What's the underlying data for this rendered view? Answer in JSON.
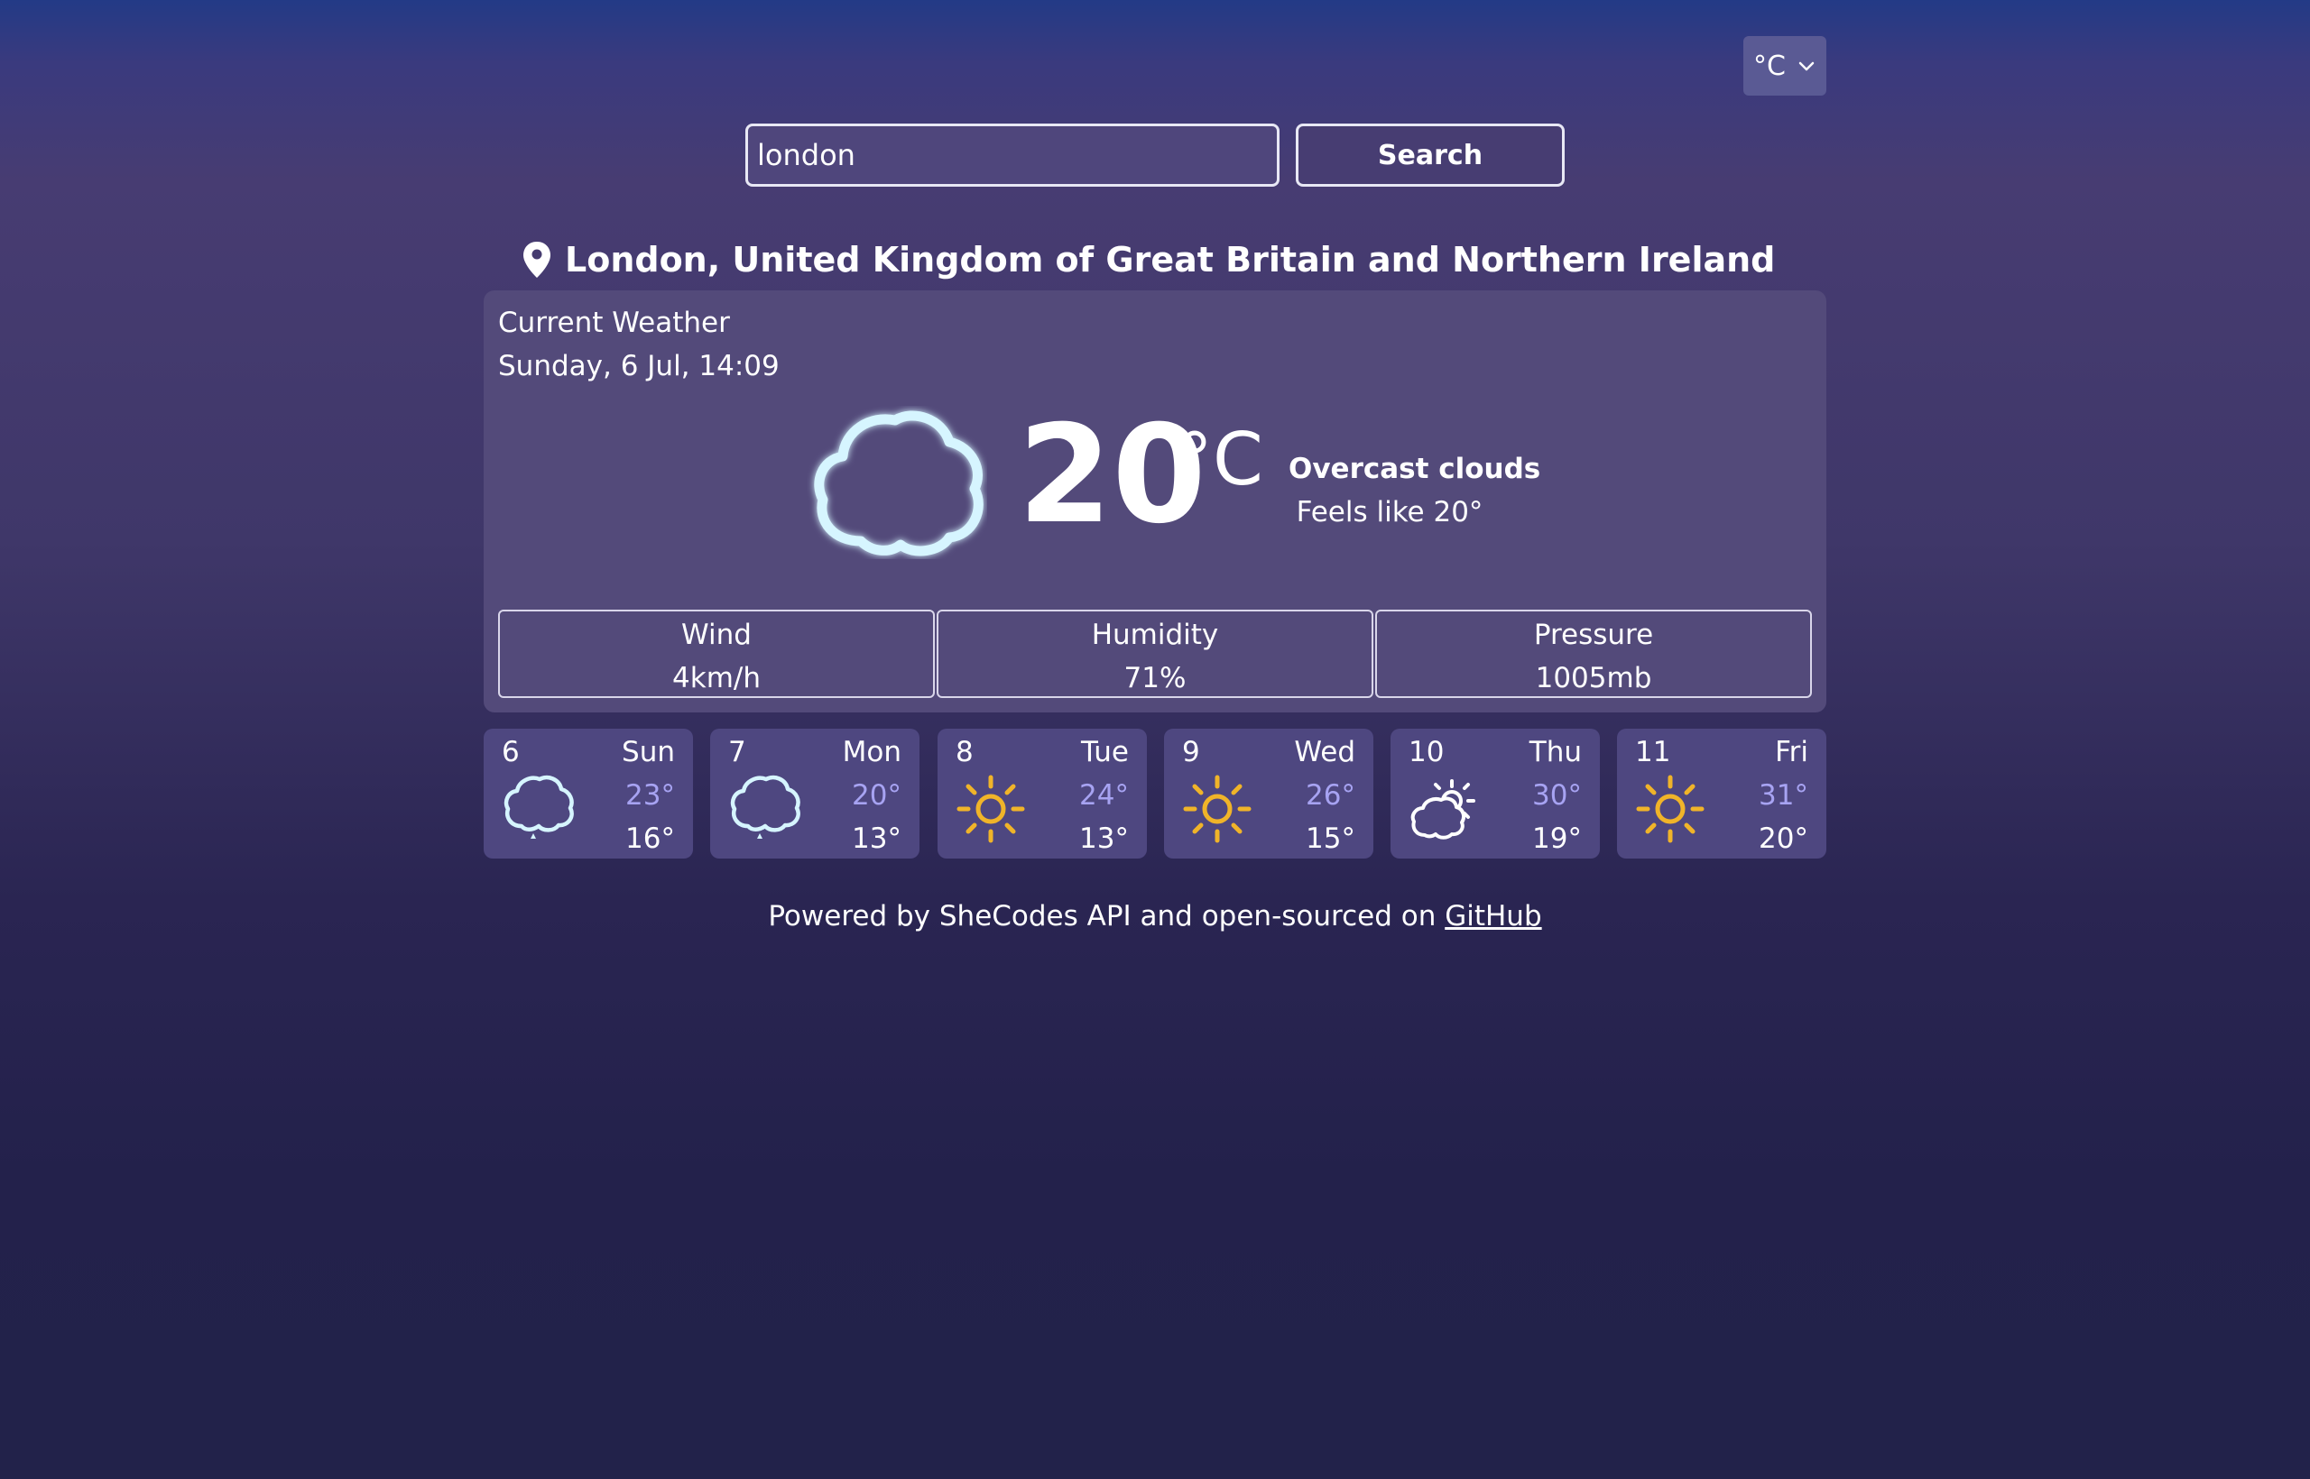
{
  "unit_selector": {
    "value": "°C"
  },
  "search": {
    "value": "london",
    "button_label": "Search"
  },
  "location": {
    "name": "London, United Kingdom of Great Britain and Northern Ireland"
  },
  "current": {
    "label": "Current Weather",
    "datetime": "Sunday, 6 Jul, 14:09",
    "temperature": "20",
    "unit": "°C",
    "description": "Overcast clouds",
    "feels_like": "Feels like 20°",
    "icon": "cloud-icon"
  },
  "stats": [
    {
      "label": "Wind",
      "value": "4km/h"
    },
    {
      "label": "Humidity",
      "value": "71%"
    },
    {
      "label": "Pressure",
      "value": "1005mb"
    }
  ],
  "forecast": [
    {
      "date": "6",
      "day": "Sun",
      "high": "23°",
      "low": "16°",
      "icon": "cloud-icon"
    },
    {
      "date": "7",
      "day": "Mon",
      "high": "20°",
      "low": "13°",
      "icon": "cloud-icon"
    },
    {
      "date": "8",
      "day": "Tue",
      "high": "24°",
      "low": "13°",
      "icon": "sun-icon"
    },
    {
      "date": "9",
      "day": "Wed",
      "high": "26°",
      "low": "15°",
      "icon": "sun-icon"
    },
    {
      "date": "10",
      "day": "Thu",
      "high": "30°",
      "low": "19°",
      "icon": "partly-cloudy-icon"
    },
    {
      "date": "11",
      "day": "Fri",
      "high": "31°",
      "low": "20°",
      "icon": "sun-icon"
    }
  ],
  "footer": {
    "prefix": "Powered by SheCodes API and open-sourced on ",
    "link": "GitHub"
  },
  "colors": {
    "card": "#534a7a",
    "forecast_card": "#4e4780",
    "high_temp": "#a7a3f2",
    "sun": "#f0b429",
    "cloud_glow": "#cdf3ff"
  }
}
